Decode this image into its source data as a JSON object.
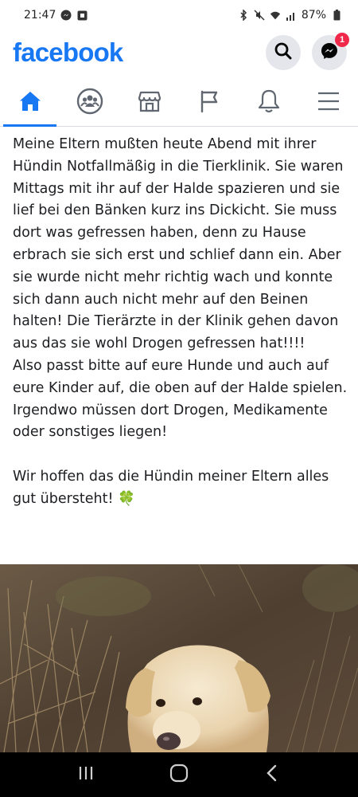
{
  "status_bar": {
    "time": "21:47",
    "battery": "87%"
  },
  "header": {
    "logo": "facebook",
    "messenger_badge": "1"
  },
  "nav": {
    "tabs": [
      "home-icon",
      "groups-icon",
      "marketplace-icon",
      "pages-flag-icon",
      "notifications-bell-icon",
      "menu-icon"
    ],
    "active_tab": "home-icon"
  },
  "post": {
    "text": "Meine Eltern mußten heute Abend mit ihrer Hündin Notfallmäßig in die Tierklinik.  Sie waren Mittags mit ihr auf der Halde spazieren und sie lief bei den Bänken kurz ins Dickicht. Sie muss dort was gefressen haben, denn zu Hause erbrach sie sich erst und schlief dann ein. Aber sie wurde nicht mehr richtig wach und konnte sich dann auch nicht mehr auf den Beinen halten! Die Tierärzte in der Klinik gehen davon aus das sie wohl Drogen gefressen hat!!!!\nAlso passt bitte auf eure Hunde und auch auf eure Kinder auf, die oben auf der Halde spielen.\nIrgendwo müssen dort Drogen, Medikamente oder sonstiges liegen!\n\nWir hoffen das die Hündin meiner Eltern alles gut übersteht! 🍀"
  },
  "colors": {
    "brand": "#1877f2",
    "badge": "#f02849"
  }
}
